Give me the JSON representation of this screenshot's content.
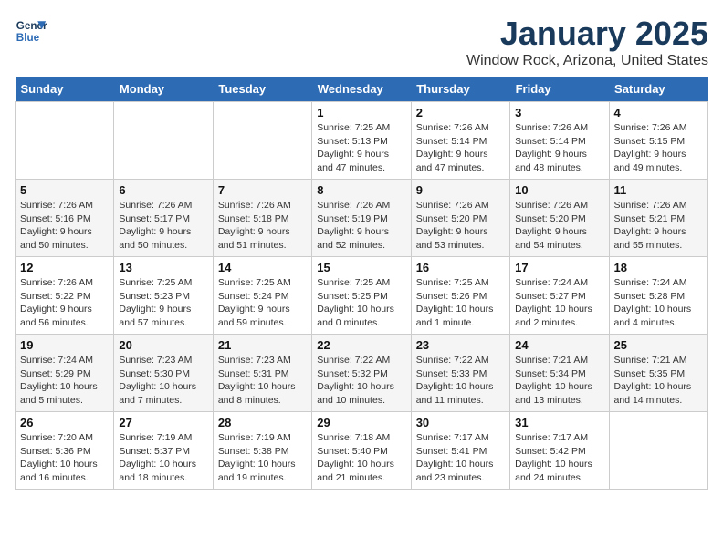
{
  "header": {
    "logo_line1": "General",
    "logo_line2": "Blue",
    "title": "January 2025",
    "subtitle": "Window Rock, Arizona, United States"
  },
  "days_of_week": [
    "Sunday",
    "Monday",
    "Tuesday",
    "Wednesday",
    "Thursday",
    "Friday",
    "Saturday"
  ],
  "weeks": [
    [
      {
        "day": null,
        "text": null
      },
      {
        "day": null,
        "text": null
      },
      {
        "day": null,
        "text": null
      },
      {
        "day": "1",
        "text": "Sunrise: 7:25 AM\nSunset: 5:13 PM\nDaylight: 9 hours and 47 minutes."
      },
      {
        "day": "2",
        "text": "Sunrise: 7:26 AM\nSunset: 5:14 PM\nDaylight: 9 hours and 47 minutes."
      },
      {
        "day": "3",
        "text": "Sunrise: 7:26 AM\nSunset: 5:14 PM\nDaylight: 9 hours and 48 minutes."
      },
      {
        "day": "4",
        "text": "Sunrise: 7:26 AM\nSunset: 5:15 PM\nDaylight: 9 hours and 49 minutes."
      }
    ],
    [
      {
        "day": "5",
        "text": "Sunrise: 7:26 AM\nSunset: 5:16 PM\nDaylight: 9 hours and 50 minutes."
      },
      {
        "day": "6",
        "text": "Sunrise: 7:26 AM\nSunset: 5:17 PM\nDaylight: 9 hours and 50 minutes."
      },
      {
        "day": "7",
        "text": "Sunrise: 7:26 AM\nSunset: 5:18 PM\nDaylight: 9 hours and 51 minutes."
      },
      {
        "day": "8",
        "text": "Sunrise: 7:26 AM\nSunset: 5:19 PM\nDaylight: 9 hours and 52 minutes."
      },
      {
        "day": "9",
        "text": "Sunrise: 7:26 AM\nSunset: 5:20 PM\nDaylight: 9 hours and 53 minutes."
      },
      {
        "day": "10",
        "text": "Sunrise: 7:26 AM\nSunset: 5:20 PM\nDaylight: 9 hours and 54 minutes."
      },
      {
        "day": "11",
        "text": "Sunrise: 7:26 AM\nSunset: 5:21 PM\nDaylight: 9 hours and 55 minutes."
      }
    ],
    [
      {
        "day": "12",
        "text": "Sunrise: 7:26 AM\nSunset: 5:22 PM\nDaylight: 9 hours and 56 minutes."
      },
      {
        "day": "13",
        "text": "Sunrise: 7:25 AM\nSunset: 5:23 PM\nDaylight: 9 hours and 57 minutes."
      },
      {
        "day": "14",
        "text": "Sunrise: 7:25 AM\nSunset: 5:24 PM\nDaylight: 9 hours and 59 minutes."
      },
      {
        "day": "15",
        "text": "Sunrise: 7:25 AM\nSunset: 5:25 PM\nDaylight: 10 hours and 0 minutes."
      },
      {
        "day": "16",
        "text": "Sunrise: 7:25 AM\nSunset: 5:26 PM\nDaylight: 10 hours and 1 minute."
      },
      {
        "day": "17",
        "text": "Sunrise: 7:24 AM\nSunset: 5:27 PM\nDaylight: 10 hours and 2 minutes."
      },
      {
        "day": "18",
        "text": "Sunrise: 7:24 AM\nSunset: 5:28 PM\nDaylight: 10 hours and 4 minutes."
      }
    ],
    [
      {
        "day": "19",
        "text": "Sunrise: 7:24 AM\nSunset: 5:29 PM\nDaylight: 10 hours and 5 minutes."
      },
      {
        "day": "20",
        "text": "Sunrise: 7:23 AM\nSunset: 5:30 PM\nDaylight: 10 hours and 7 minutes."
      },
      {
        "day": "21",
        "text": "Sunrise: 7:23 AM\nSunset: 5:31 PM\nDaylight: 10 hours and 8 minutes."
      },
      {
        "day": "22",
        "text": "Sunrise: 7:22 AM\nSunset: 5:32 PM\nDaylight: 10 hours and 10 minutes."
      },
      {
        "day": "23",
        "text": "Sunrise: 7:22 AM\nSunset: 5:33 PM\nDaylight: 10 hours and 11 minutes."
      },
      {
        "day": "24",
        "text": "Sunrise: 7:21 AM\nSunset: 5:34 PM\nDaylight: 10 hours and 13 minutes."
      },
      {
        "day": "25",
        "text": "Sunrise: 7:21 AM\nSunset: 5:35 PM\nDaylight: 10 hours and 14 minutes."
      }
    ],
    [
      {
        "day": "26",
        "text": "Sunrise: 7:20 AM\nSunset: 5:36 PM\nDaylight: 10 hours and 16 minutes."
      },
      {
        "day": "27",
        "text": "Sunrise: 7:19 AM\nSunset: 5:37 PM\nDaylight: 10 hours and 18 minutes."
      },
      {
        "day": "28",
        "text": "Sunrise: 7:19 AM\nSunset: 5:38 PM\nDaylight: 10 hours and 19 minutes."
      },
      {
        "day": "29",
        "text": "Sunrise: 7:18 AM\nSunset: 5:40 PM\nDaylight: 10 hours and 21 minutes."
      },
      {
        "day": "30",
        "text": "Sunrise: 7:17 AM\nSunset: 5:41 PM\nDaylight: 10 hours and 23 minutes."
      },
      {
        "day": "31",
        "text": "Sunrise: 7:17 AM\nSunset: 5:42 PM\nDaylight: 10 hours and 24 minutes."
      },
      {
        "day": null,
        "text": null
      }
    ]
  ]
}
